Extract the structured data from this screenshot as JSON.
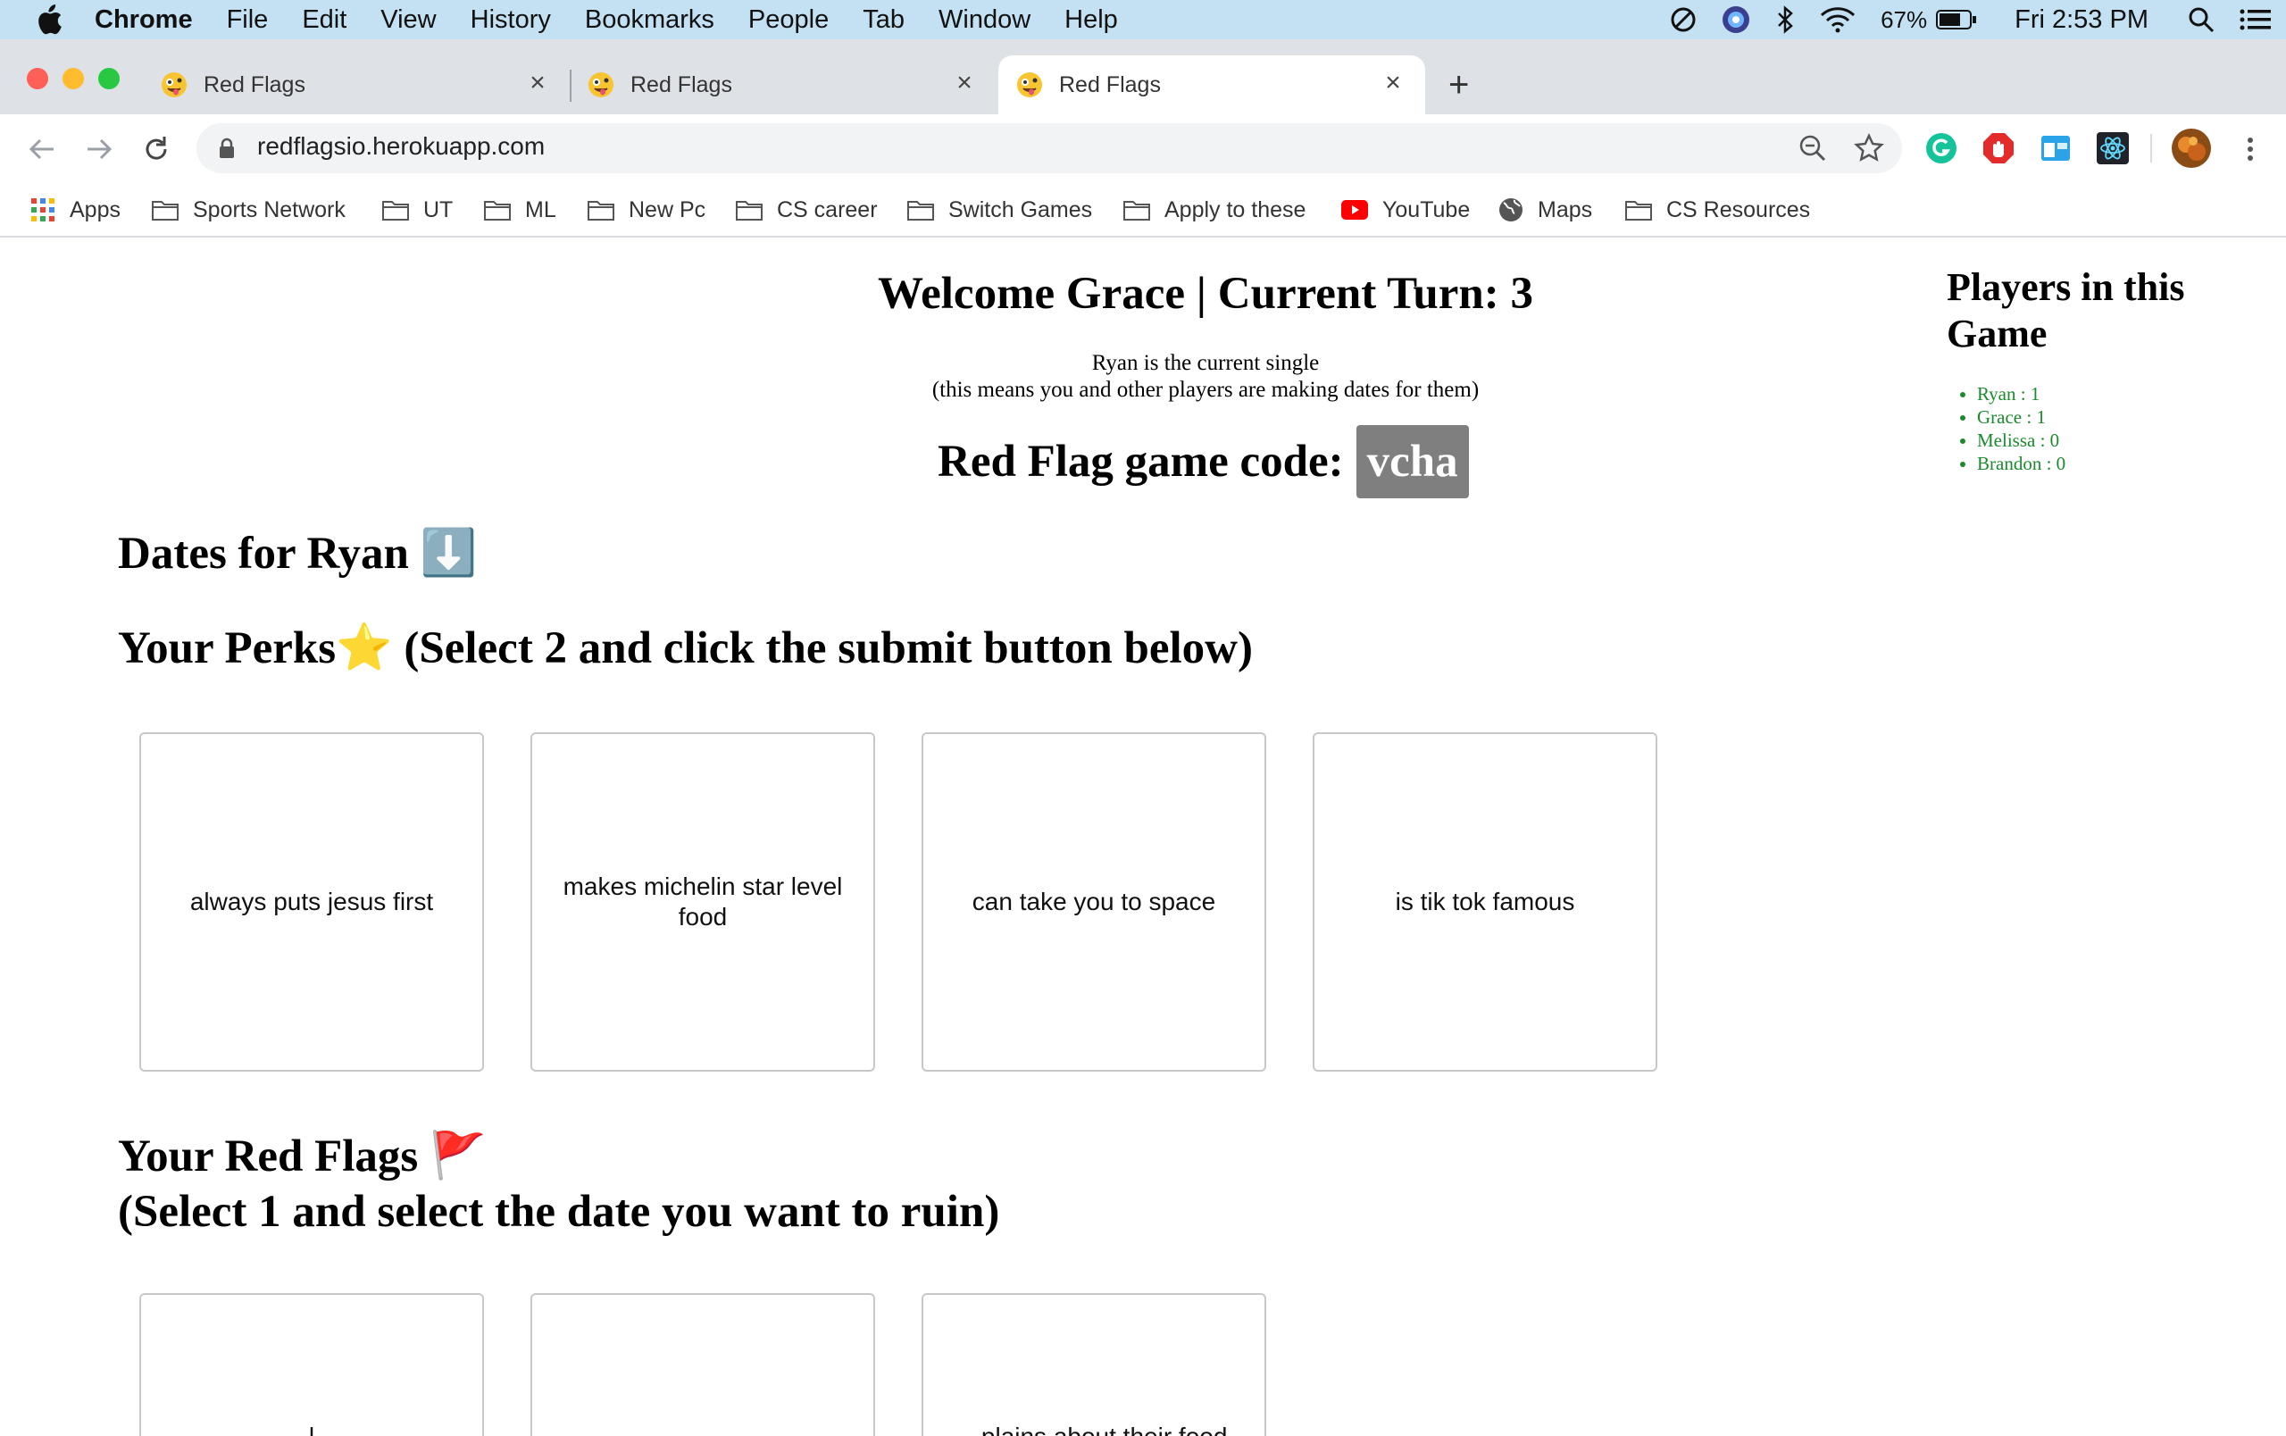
{
  "menubar": {
    "app_name": "Chrome",
    "items": [
      "File",
      "Edit",
      "View",
      "History",
      "Bookmarks",
      "People",
      "Tab",
      "Window",
      "Help"
    ],
    "battery": "67%",
    "clock": "Fri 2:53 PM"
  },
  "tabs": [
    {
      "title": "Red Flags",
      "active": false
    },
    {
      "title": "Red Flags",
      "active": false
    },
    {
      "title": "Red Flags",
      "active": true
    }
  ],
  "address_bar": {
    "url": "redflagsio.herokuapp.com"
  },
  "bookmarks": [
    {
      "label": "Apps",
      "icon": "apps-grid-icon"
    },
    {
      "label": "Sports Network",
      "icon": "folder-icon"
    },
    {
      "label": "UT",
      "icon": "folder-icon"
    },
    {
      "label": "ML",
      "icon": "folder-icon"
    },
    {
      "label": "New Pc",
      "icon": "folder-icon"
    },
    {
      "label": "CS career",
      "icon": "folder-icon"
    },
    {
      "label": "Switch Games",
      "icon": "folder-icon"
    },
    {
      "label": "Apply to these",
      "icon": "folder-icon"
    },
    {
      "label": "YouTube",
      "icon": "youtube-icon"
    },
    {
      "label": "Maps",
      "icon": "globe-icon"
    },
    {
      "label": "CS Resources",
      "icon": "folder-icon"
    }
  ],
  "game": {
    "welcome": "Welcome Grace | Current Turn: 3",
    "single_line1": "Ryan is the current single",
    "single_line2": "(this means you and other players are making dates for them)",
    "code_label": "Red Flag game code:",
    "code": "vcha",
    "dates_heading": "Dates for Ryan ⬇️",
    "perks_heading": "Your Perks⭐ (Select 2 and click the submit button below)",
    "perks": [
      "always puts jesus first",
      "makes michelin star level food",
      "can take you to space",
      "is tik tok famous"
    ],
    "redflags_heading_line1": "Your Red Flags 🚩",
    "redflags_heading_line2": "(Select 1 and select the date you want to ruin)",
    "redflags_partial": [
      "...l...",
      "",
      "...plains about their food"
    ]
  },
  "players": {
    "title": "Players in this Game",
    "list": [
      "Ryan : 1",
      "Grace : 1",
      "Melissa : 0",
      "Brandon : 0"
    ]
  },
  "colors": {
    "menubar": "#c3e1f2",
    "tabstrip": "#dee1e6",
    "code_box": "#7f7f7f",
    "players_text": "#1b8a2e"
  }
}
